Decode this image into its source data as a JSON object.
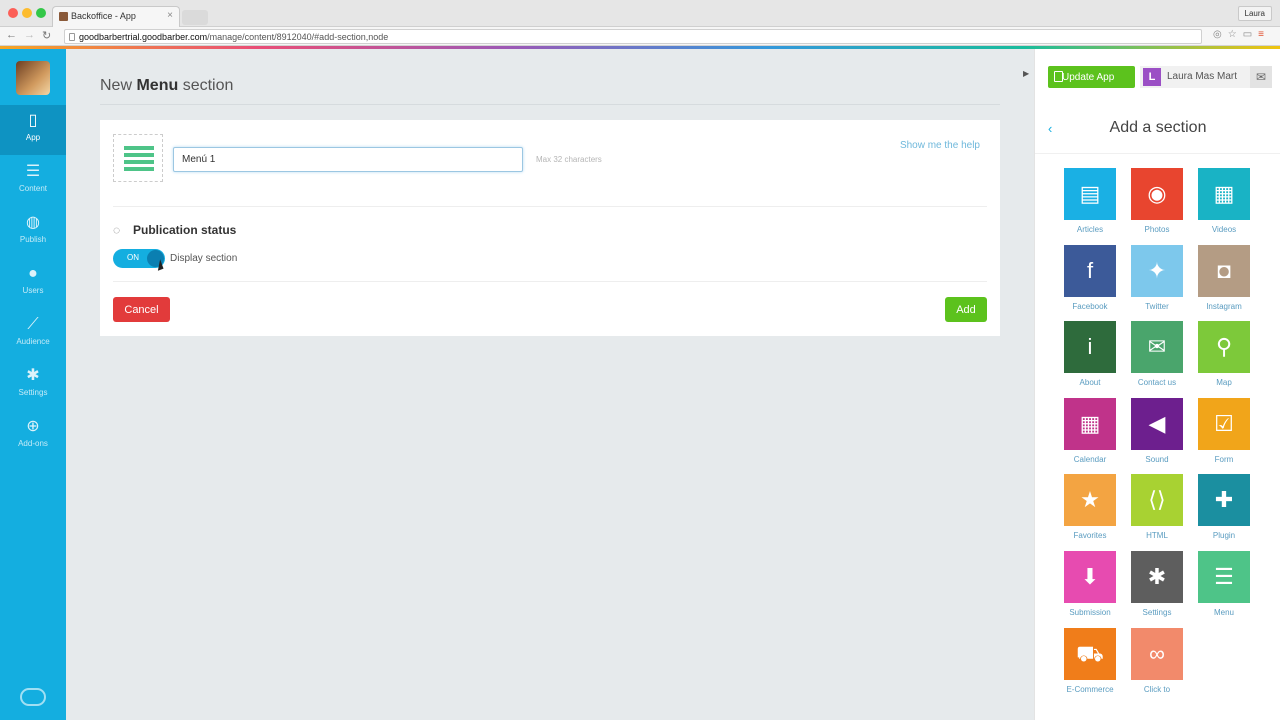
{
  "browser": {
    "tab_title": "Backoffice - App",
    "tab_close": "×",
    "user": "Laura",
    "back": "←",
    "forward": "→",
    "reload": "↻",
    "url_host": "goodbarbertrial.goodbarber.com",
    "url_path": "/manage/content/8912040/#add-section,node"
  },
  "sidebar": {
    "items": [
      {
        "label": "App",
        "icon": "▯",
        "icon_name": "phone-icon",
        "active": true
      },
      {
        "label": "Content",
        "icon": "☰",
        "icon_name": "content-icon"
      },
      {
        "label": "Publish",
        "icon": "◍",
        "icon_name": "globe-icon"
      },
      {
        "label": "Users",
        "icon": "●",
        "icon_name": "user-icon"
      },
      {
        "label": "Audience",
        "icon": "⟋",
        "icon_name": "chart-icon"
      },
      {
        "label": "Settings",
        "icon": "✱",
        "icon_name": "gear-icon"
      },
      {
        "label": "Add-ons",
        "icon": "⊕",
        "icon_name": "plus-circle-icon"
      }
    ]
  },
  "main": {
    "title_prefix": "New",
    "title_bold": "Menu",
    "title_suffix": "section",
    "name_value": "Menú 1",
    "max_chars": "Max 32 characters",
    "help_link": "Show me the help",
    "publication_status": "Publication status",
    "eye_icon": "◌",
    "toggle_label": "ON",
    "display_section": "Display section",
    "cancel": "Cancel",
    "add": "Add"
  },
  "right_panel": {
    "update_app": "Update App",
    "user_initial": "L",
    "user_name": "Laura Mas Mart",
    "mail_icon": "✉",
    "back_icon": "‹",
    "title": "Add a section",
    "tiles": [
      {
        "label": "Articles",
        "glyph": "▤",
        "color": "#1ab0e4",
        "icon": "article-icon"
      },
      {
        "label": "Photos",
        "glyph": "◉",
        "color": "#e8452f",
        "icon": "camera-icon"
      },
      {
        "label": "Videos",
        "glyph": "▦",
        "color": "#19b3c5",
        "icon": "film-icon"
      },
      {
        "label": "Facebook",
        "glyph": "f",
        "color": "#3c5a99",
        "icon": "facebook-icon"
      },
      {
        "label": "Twitter",
        "glyph": "✦",
        "color": "#7dc8ec",
        "icon": "twitter-icon"
      },
      {
        "label": "Instagram",
        "glyph": "◘",
        "color": "#b49c84",
        "icon": "instagram-icon"
      },
      {
        "label": "About",
        "glyph": "i",
        "color": "#2e6b3c",
        "icon": "info-icon"
      },
      {
        "label": "Contact us",
        "glyph": "✉",
        "color": "#4aa56c",
        "icon": "mail-icon"
      },
      {
        "label": "Map",
        "glyph": "⚲",
        "color": "#7dc93a",
        "icon": "map-pin-icon"
      },
      {
        "label": "Calendar",
        "glyph": "▦",
        "color": "#c0338a",
        "icon": "calendar-icon"
      },
      {
        "label": "Sound",
        "glyph": "◀",
        "color": "#6d1f8e",
        "icon": "speaker-icon"
      },
      {
        "label": "Form",
        "glyph": "☑",
        "color": "#f1a51a",
        "icon": "checkbox-icon"
      },
      {
        "label": "Favorites",
        "glyph": "★",
        "color": "#f3a442",
        "icon": "star-icon"
      },
      {
        "label": "HTML",
        "glyph": "⟨⟩",
        "color": "#a8d232",
        "icon": "code-icon"
      },
      {
        "label": "Plugin",
        "glyph": "✚",
        "color": "#1b8fa0",
        "icon": "puzzle-icon"
      },
      {
        "label": "Submission",
        "glyph": "⬇",
        "color": "#e74bb0",
        "icon": "download-icon"
      },
      {
        "label": "Settings",
        "glyph": "✱",
        "color": "#5e5e5e",
        "icon": "gear-icon"
      },
      {
        "label": "Menu",
        "glyph": "☰",
        "color": "#4ec488",
        "icon": "list-icon"
      },
      {
        "label": "E-Commerce",
        "glyph": "⛟",
        "color": "#f07d1a",
        "icon": "cart-icon"
      },
      {
        "label": "Click to",
        "glyph": "∞",
        "color": "#f28a6b",
        "icon": "link-icon"
      }
    ]
  }
}
